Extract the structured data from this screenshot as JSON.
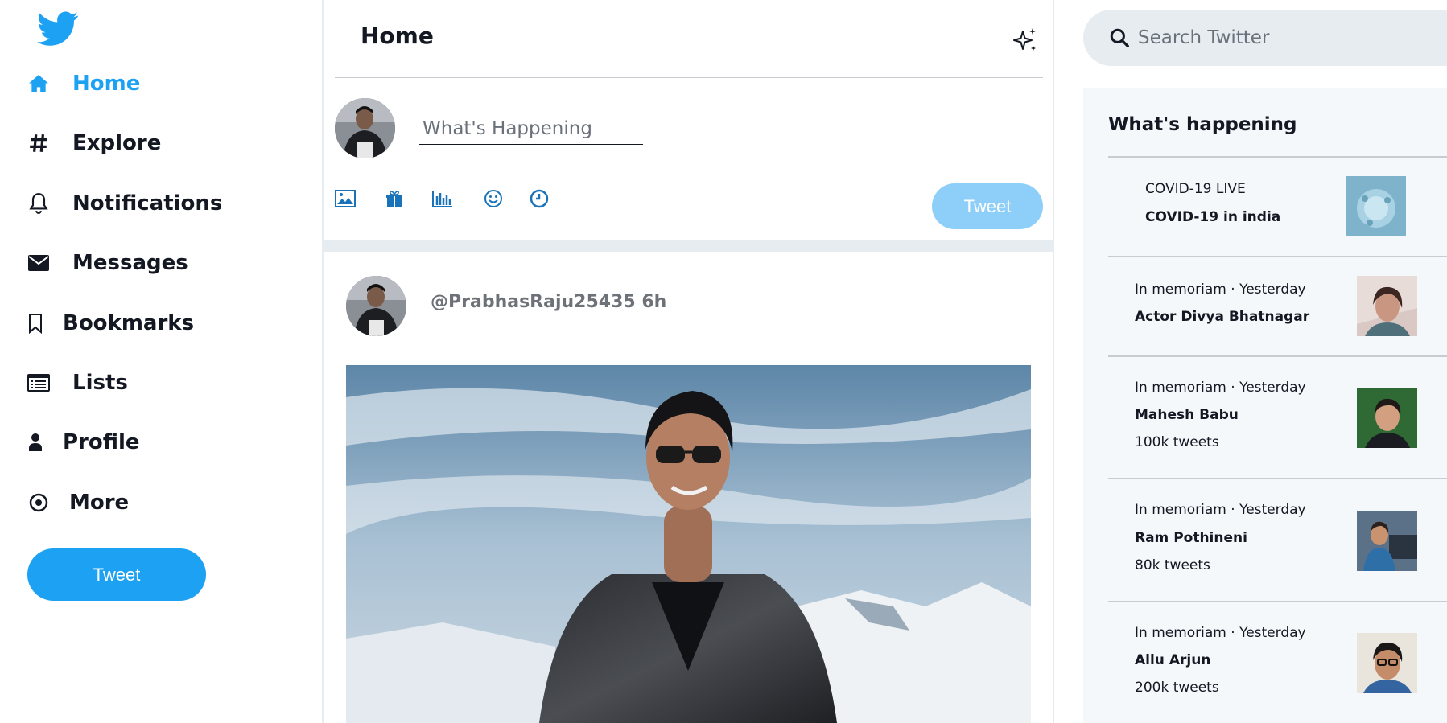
{
  "sidebar": {
    "logo_icon": "twitter-bird-icon",
    "items": [
      {
        "label": "Home",
        "icon": "home-icon",
        "active": true
      },
      {
        "label": "Explore",
        "icon": "hashtag-icon"
      },
      {
        "label": "Notifications",
        "icon": "bell-icon"
      },
      {
        "label": "Messages",
        "icon": "envelope-icon"
      },
      {
        "label": "Bookmarks",
        "icon": "bookmark-icon"
      },
      {
        "label": "Lists",
        "icon": "list-icon"
      },
      {
        "label": "Profile",
        "icon": "user-icon"
      },
      {
        "label": "More",
        "icon": "more-circle-icon"
      }
    ],
    "tweet_button": "Tweet"
  },
  "feed": {
    "title": "Home",
    "sparkle_icon": "sparkle-icon",
    "composer": {
      "placeholder": "What's Happening",
      "tools": [
        "image-icon",
        "gif-icon",
        "poll-icon",
        "emoji-icon",
        "schedule-icon"
      ],
      "tweet_button": "Tweet"
    },
    "post": {
      "handle_time": "@PrabhasRaju25435 6h"
    }
  },
  "search": {
    "placeholder": "Search Twitter"
  },
  "trends": {
    "title": "What's happening",
    "items": [
      {
        "category": "COVID-19 LIVE",
        "topic": "COVID-19 in india",
        "count": ""
      },
      {
        "category": "In memoriam · Yesterday",
        "topic": "Actor Divya Bhatnagar",
        "count": ""
      },
      {
        "category": "In memoriam · Yesterday",
        "topic": "Mahesh Babu",
        "count": "100k tweets"
      },
      {
        "category": "In memoriam · Yesterday",
        "topic": "Ram Pothineni",
        "count": "80k tweets"
      },
      {
        "category": "In memoriam · Yesterday",
        "topic": "Allu Arjun",
        "count": "200k tweets"
      }
    ]
  },
  "colors": {
    "brand": "#1da1f2",
    "brand_light": "#8dcff8",
    "feed_bg": "#e6ecf0",
    "text": "#141823"
  }
}
